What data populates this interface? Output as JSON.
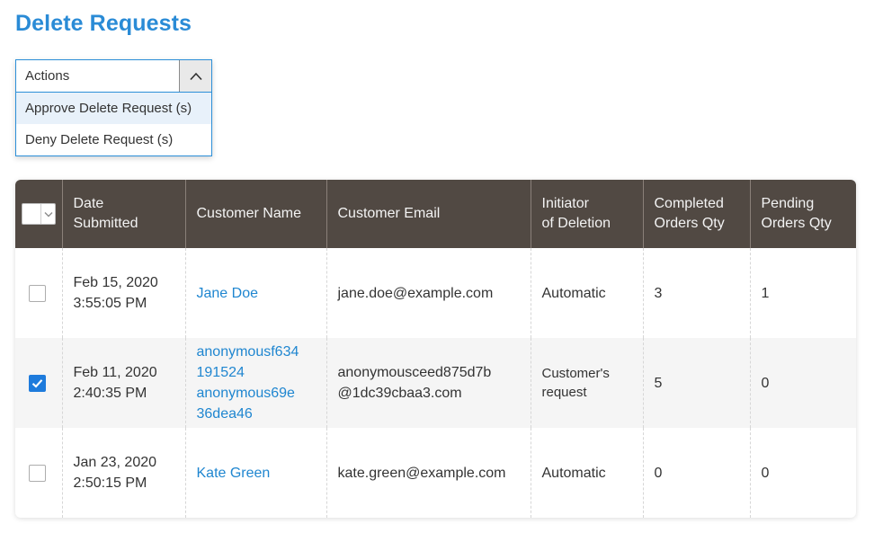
{
  "page": {
    "title": "Delete Requests"
  },
  "actions": {
    "label": "Actions",
    "options": [
      "Approve Delete Request (s)",
      "Deny Delete Request (s)"
    ]
  },
  "grid": {
    "headers": {
      "date": [
        "Date",
        "Submitted"
      ],
      "customer_name": [
        "Customer Name"
      ],
      "customer_email": [
        "Customer Email"
      ],
      "initiator": [
        "Initiator",
        "of Deletion"
      ],
      "completed": [
        "Completed",
        "Orders Qty"
      ],
      "pending": [
        "Pending",
        "Orders Qty"
      ]
    },
    "rows": [
      {
        "checked": false,
        "date": "Feb 15, 2020",
        "time": "3:55:05 PM",
        "name": [
          "Jane Doe"
        ],
        "email": [
          "jane.doe@example.com"
        ],
        "initiator": [
          "Automatic"
        ],
        "completed": "3",
        "pending": "1"
      },
      {
        "checked": true,
        "date": "Feb 11, 2020",
        "time": "2:40:35 PM",
        "name": [
          "anonymousf634",
          "191524",
          "anonymous69e",
          "36dea46"
        ],
        "email": [
          "anonymousceed875d7b",
          "@1dc39cbaa3.com"
        ],
        "initiator": [
          "Customer's",
          "request"
        ],
        "completed": "5",
        "pending": "0"
      },
      {
        "checked": false,
        "date": "Jan 23, 2020",
        "time": "2:50:15 PM",
        "name": [
          "Kate Green"
        ],
        "email": [
          "kate.green@example.com"
        ],
        "initiator": [
          "Automatic"
        ],
        "completed": "0",
        "pending": "0"
      }
    ]
  },
  "colors": {
    "accent": "#2a8bd6",
    "link": "#1f86d0",
    "header_bg": "#514943",
    "checkbox_checked": "#1e7bdc"
  },
  "icons": {
    "actions_toggle": "chevron-up-icon",
    "mass_select": "chevron-down-icon",
    "checked": "checkmark-icon"
  }
}
